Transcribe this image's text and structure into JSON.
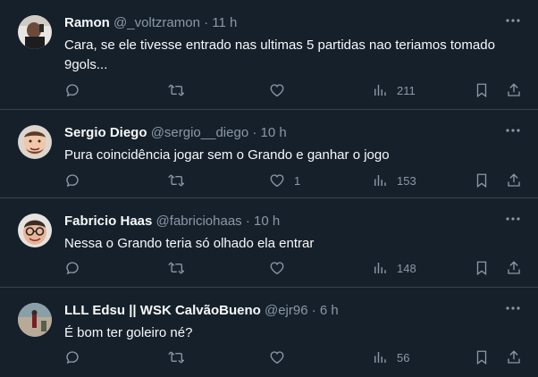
{
  "tweets": [
    {
      "name": "Ramon",
      "handle": "@_voltzramon",
      "dot": "·",
      "time": "11 h",
      "text": "Cara, se ele tivesse entrado nas ultimas 5 partidas nao teriamos tomado 9gols...",
      "likes": "",
      "views": "211"
    },
    {
      "name": "Sergio Diego",
      "handle": "@sergio__diego",
      "dot": "·",
      "time": "10 h",
      "text": "Pura coincidência jogar sem o Grando e ganhar o jogo",
      "likes": "1",
      "views": "153"
    },
    {
      "name": "Fabricio Haas",
      "handle": "@fabriciohaas",
      "dot": "·",
      "time": "10 h",
      "text": "Nessa o Grando teria só olhado ela entrar",
      "likes": "",
      "views": "148"
    },
    {
      "name": "LLL Edsu || WSK CalvãoBueno",
      "handle": "@ejr96",
      "dot": "·",
      "time": "6 h",
      "text": "É bom ter goleiro né?",
      "likes": "",
      "views": "56"
    }
  ],
  "icons": {
    "more": "more-horizontal-icon",
    "reply": "reply-icon",
    "retweet": "retweet-icon",
    "like": "heart-icon",
    "views": "views-chart-icon",
    "bookmark": "bookmark-icon",
    "share": "share-icon"
  },
  "colors": {
    "background": "#15202b",
    "divider": "#38444d",
    "secondary_text": "#8b98a5",
    "primary_text": "#f7f9f9"
  }
}
